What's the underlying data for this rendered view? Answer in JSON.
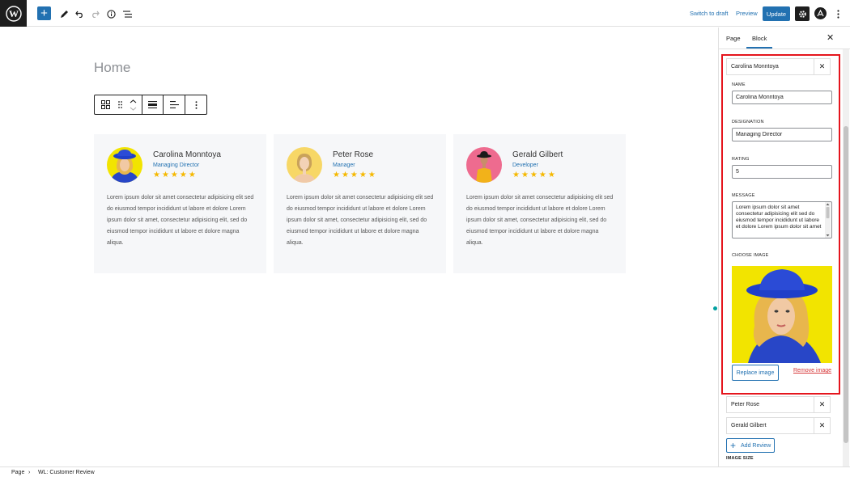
{
  "topbar": {
    "add_block_label": "+",
    "switch_to_draft": "Switch to draft",
    "preview": "Preview",
    "update": "Update"
  },
  "page": {
    "title": "Home"
  },
  "reviews": [
    {
      "name": "Carolina Monntoya",
      "designation": "Managing Director",
      "stars": "★★★★★",
      "message": "Lorem ipsum dolor sit amet consectetur adipisicing elit sed do eiusmod tempor incididunt ut labore et dolore Lorem ipsum dolor sit amet, consectetur adipisicing elit, sed do eiusmod tempor incididunt ut labore et dolore magna aliqua.",
      "avatar_colors": {
        "bg": "#2b4bd6",
        "hat": "#1f3fc9",
        "hair": "#e8b64d",
        "body": "#2846c7"
      }
    },
    {
      "name": "Peter Rose",
      "designation": "Manager",
      "stars": "★★★★★",
      "message": "Lorem ipsum dolor sit amet consectetur adipisicing elit sed do eiusmod tempor incididunt ut labore et dolore Lorem ipsum dolor sit amet, consectetur adipisicing elit, sed do eiusmod tempor incididunt ut labore et dolore magna aliqua.",
      "avatar_colors": {
        "bg": "#f7d766",
        "hair": "#c9a25a",
        "body": "#f0c9a8"
      }
    },
    {
      "name": "Gerald Gilbert",
      "designation": "Developer",
      "stars": "★★★★★",
      "message": "Lorem ipsum dolor sit amet consectetur adipisicing elit sed do eiusmod tempor incididunt ut labore et dolore Lorem ipsum dolor sit amet, consectetur adipisicing elit, sed do eiusmod tempor incididunt ut labore et dolore magna aliqua.",
      "avatar_colors": {
        "bg": "#ee6b8f",
        "hat": "#1a1a1a",
        "body": "#f2b21a"
      }
    }
  ],
  "sidebar": {
    "tabs": [
      "Page",
      "Block"
    ],
    "active_tab": "Block",
    "expanded_item": {
      "header": "Carolina Monntoya",
      "name_label": "NAME",
      "name_value": "Carolina Monntoya",
      "designation_label": "DESIGNATION",
      "designation_value": "Managing Director",
      "rating_label": "RATING",
      "rating_value": "5",
      "message_label": "MESSAGE",
      "message_value": "Lorem ipsum dolor sit amet consectetur adipisicing elit sed do eiusmod tempor incididunt ut labore et dolore Lorem ipsum dolor sit amet",
      "choose_image_label": "CHOOSE IMAGE",
      "replace_image": "Replace image",
      "remove_image": "Remove image"
    },
    "collapsed_items": [
      "Peter Rose",
      "Gerald Gilbert"
    ],
    "add_review": "Add Review",
    "image_size_label": "IMAGE SIZE"
  },
  "breadcrumb": [
    "Page",
    "WL: Customer Review"
  ],
  "colors": {
    "accent": "#2271b1",
    "highlight": "#e5151d",
    "star": "#f5b800",
    "card_bg": "#f6f7f9"
  }
}
